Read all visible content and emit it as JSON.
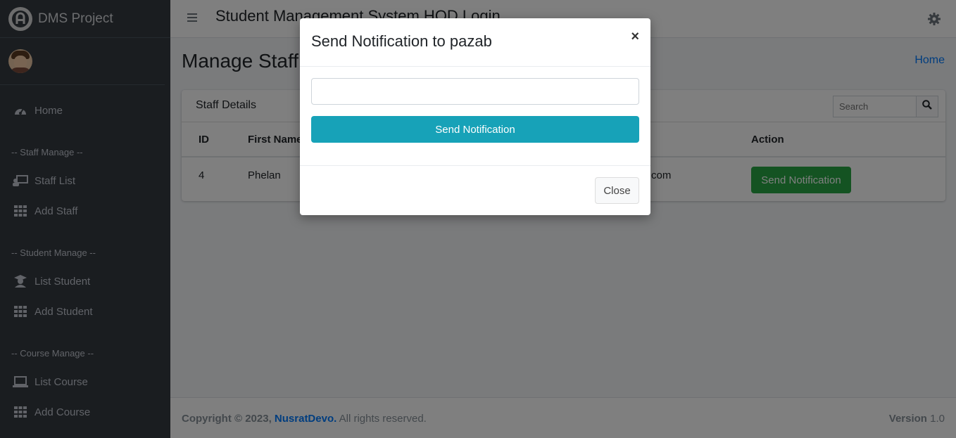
{
  "brand": {
    "name": "DMS Project"
  },
  "navbar": {
    "title": "Student Management System HOD Login"
  },
  "sidebar": {
    "home": "Home",
    "headers": [
      "-- Staff Manage --",
      "-- Student Manage --",
      "-- Course Manage --"
    ],
    "items": [
      {
        "label": "Staff List",
        "icon": "staff-list-icon"
      },
      {
        "label": "Add Staff",
        "icon": "grid-icon"
      },
      {
        "label": "List Student",
        "icon": "student-icon"
      },
      {
        "label": "Add Student",
        "icon": "grid-icon"
      },
      {
        "label": "List Course",
        "icon": "laptop-icon"
      },
      {
        "label": "Add Course",
        "icon": "grid-icon"
      }
    ]
  },
  "page": {
    "title": "Manage Staff",
    "breadcrumb": "Home"
  },
  "card": {
    "title": "Staff Details",
    "search_placeholder": "Search",
    "columns": {
      "id": "ID",
      "first_name": "First Name",
      "action": "Action"
    },
    "rows": [
      {
        "id": "4",
        "first_name": "Phelan",
        "email_tail": "com",
        "action": "Send Notification"
      }
    ]
  },
  "footer": {
    "copyright": "Copyright © 2023,",
    "author": "NusratDevo.",
    "rights": "All rights reserved.",
    "version_label": "Version",
    "version": "1.0"
  },
  "modal": {
    "title": "Send Notification to pazab",
    "close_symbol": "×",
    "input_value": "",
    "send_label": "Send Notification",
    "close_label": "Close"
  },
  "colors": {
    "sidebar_bg": "#343a40",
    "primary": "#007bff",
    "success": "#28a745",
    "info": "#17a2b8"
  }
}
